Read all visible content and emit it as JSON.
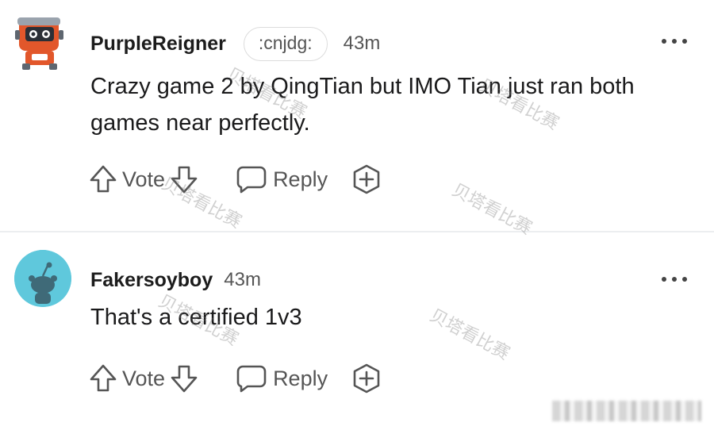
{
  "comments": [
    {
      "username": "PurpleReigner",
      "flair": ":cnjdg:",
      "time": "43m",
      "body": "Crazy game 2 by QingTian but IMO Tian just ran both games near perfectly.",
      "avatar_icon": "robot-avatar-icon",
      "vote_label": "Vote",
      "reply_label": "Reply"
    },
    {
      "username": "Fakersoyboy",
      "time": "43m",
      "body": "That's a certified 1v3",
      "avatar_icon": "snoo-avatar-icon",
      "vote_label": "Vote",
      "reply_label": "Reply"
    }
  ],
  "watermark_text": "贝塔看比赛",
  "colors": {
    "avatar2_bg": "#5fc8dc",
    "robot_orange": "#e2572b",
    "text_primary": "#1a1a1b",
    "text_meta": "#555555"
  }
}
